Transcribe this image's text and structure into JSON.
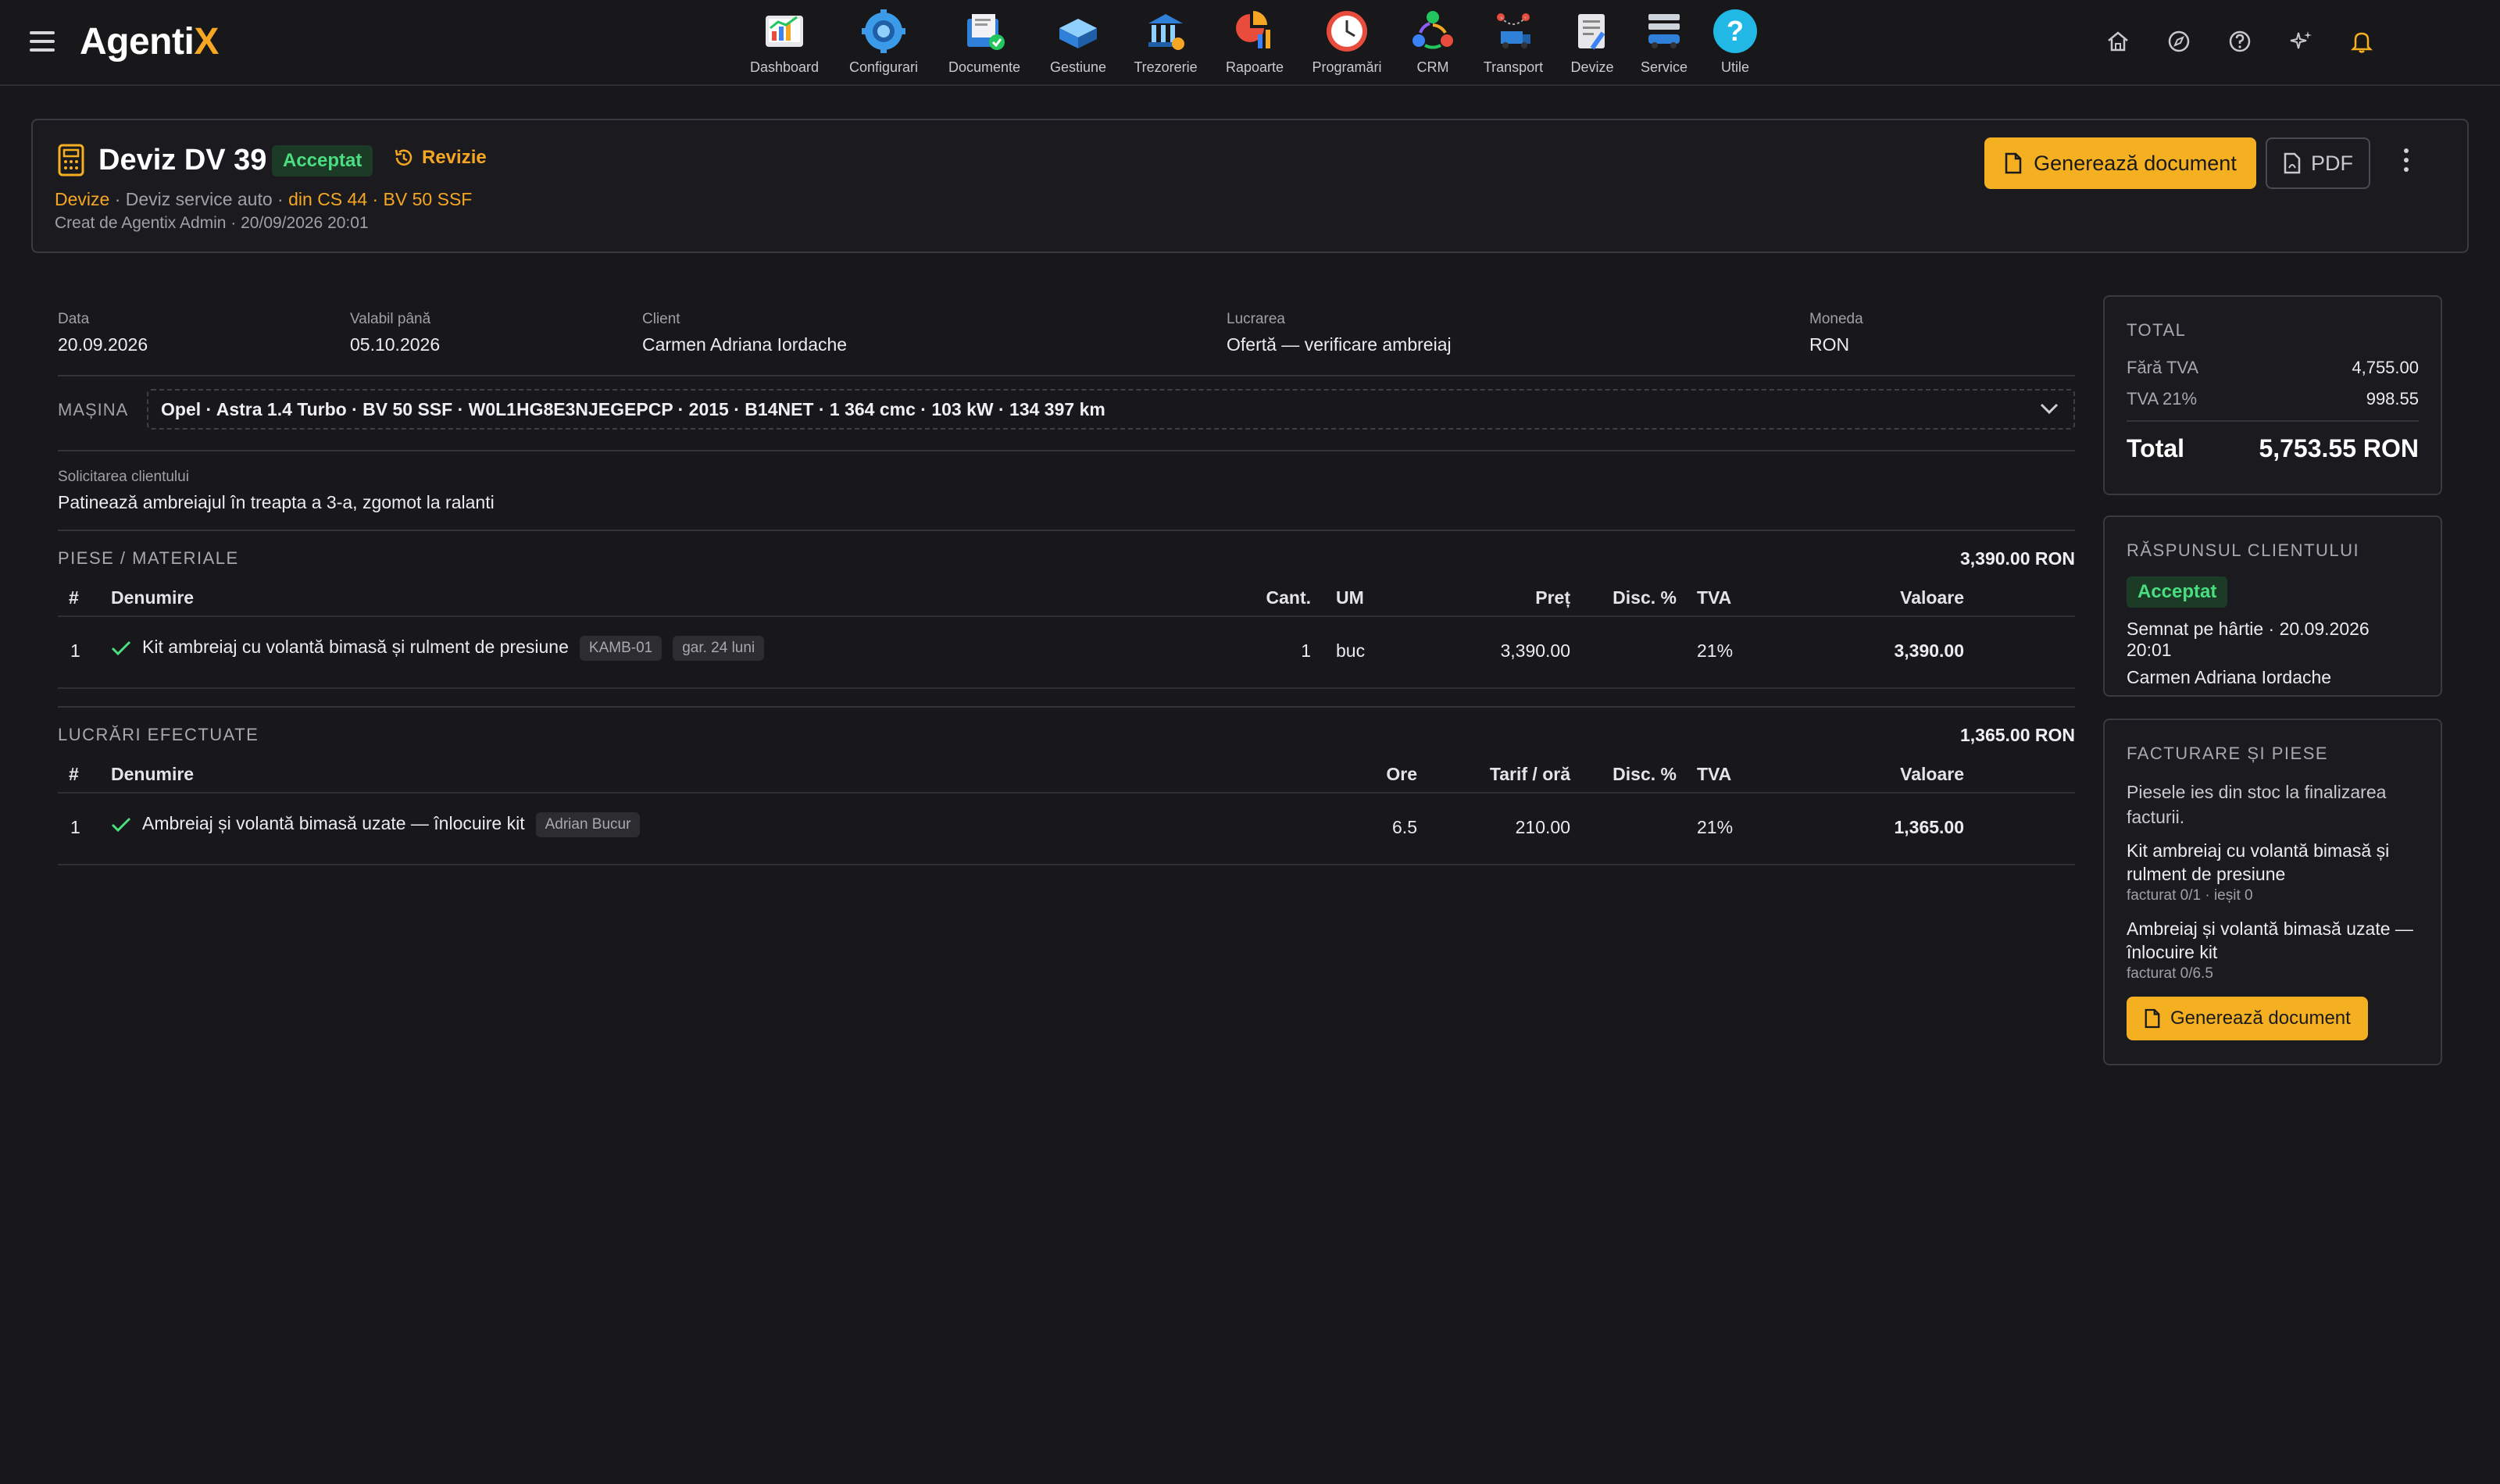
{
  "app": {
    "logo_main": "Agenti",
    "logo_accent": "X"
  },
  "nav": [
    {
      "label": "Dashboard",
      "icon": "dashboard-icon"
    },
    {
      "label": "Configurari",
      "icon": "configurari-icon"
    },
    {
      "label": "Documente",
      "icon": "documente-icon"
    },
    {
      "label": "Gestiune",
      "icon": "gestiune-icon"
    },
    {
      "label": "Trezorerie",
      "icon": "trezorerie-icon"
    },
    {
      "label": "Rapoarte",
      "icon": "rapoarte-icon"
    },
    {
      "label": "Programări",
      "icon": "programari-icon"
    },
    {
      "label": "CRM",
      "icon": "crm-icon"
    },
    {
      "label": "Transport",
      "icon": "transport-icon"
    },
    {
      "label": "Devize",
      "icon": "devize-icon"
    },
    {
      "label": "Service",
      "icon": "service-icon"
    },
    {
      "label": "Utile",
      "icon": "utile-icon"
    }
  ],
  "header": {
    "title": "Deviz DV 39",
    "status": "Acceptat",
    "revizie": "Revizie",
    "crumb_link": "Devize",
    "crumb_sep1": " · Deviz service auto · ",
    "crumb_src": "din CS 44 · BV 50 SSF",
    "created": "Creat de Agentix Admin · 20/09/2026 20:01",
    "gen_label": "Generează document",
    "pdf_label": "PDF"
  },
  "meta": {
    "data_lbl": "Data",
    "data_val": "20.09.2026",
    "valabil_lbl": "Valabil până",
    "valabil_val": "05.10.2026",
    "client_lbl": "Client",
    "client_val": "Carmen Adriana Iordache",
    "lucrarea_lbl": "Lucrarea",
    "lucrarea_val": "Ofertă — verificare ambreiaj",
    "moneda_lbl": "Moneda",
    "moneda_val": "RON"
  },
  "masina": {
    "label": "MAȘINA",
    "value": "Opel · Astra 1.4 Turbo · BV 50 SSF · W0L1HG8E3NJEGEPCP · 2015 · B14NET · 1 364 cmc · 103 kW · 134 397 km"
  },
  "request": {
    "label": "Solicitarea clientului",
    "value": "Patinează ambreiajul în treapta a 3-a, zgomot la ralanti"
  },
  "piese": {
    "title": "PIESE / MATERIALE",
    "total": "3,390.00 RON",
    "cols": {
      "nr": "#",
      "den": "Denumire",
      "cant": "Cant.",
      "um": "UM",
      "pret": "Preț",
      "disc": "Disc. %",
      "tva": "TVA",
      "val": "Valoare"
    },
    "rows": [
      {
        "nr": "1",
        "den": "Kit ambreiaj cu volantă bimasă și rulment de presiune",
        "code": "KAMB-01",
        "gar": "gar. 24 luni",
        "cant": "1",
        "um": "buc",
        "pret": "3,390.00",
        "disc": "",
        "tva": "21%",
        "val": "3,390.00"
      }
    ]
  },
  "lucrari": {
    "title": "LUCRĂRI EFECTUATE",
    "total": "1,365.00 RON",
    "cols": {
      "nr": "#",
      "den": "Denumire",
      "ore": "Ore",
      "tarif": "Tarif / oră",
      "disc": "Disc. %",
      "tva": "TVA",
      "val": "Valoare"
    },
    "rows": [
      {
        "nr": "1",
        "den": "Ambreiaj și volantă bimasă uzate — înlocuire kit",
        "tech": "Adrian Bucur",
        "ore": "6.5",
        "tarif": "210.00",
        "disc": "",
        "tva": "21%",
        "val": "1,365.00"
      }
    ]
  },
  "totals": {
    "title": "TOTAL",
    "fara_lbl": "Fără TVA",
    "fara_val": "4,755.00",
    "tva_lbl": "TVA 21%",
    "tva_val": "998.55",
    "total_lbl": "Total",
    "total_val": "5,753.55 RON"
  },
  "raspuns": {
    "title": "RĂSPUNSUL CLIENTULUI",
    "status": "Acceptat",
    "line1": "Semnat pe hârtie · 20.09.2026 20:01",
    "line2": "Carmen Adriana Iordache"
  },
  "facturare": {
    "title": "FACTURARE ȘI PIESE",
    "note": "Piesele ies din stoc la finalizarea facturii.",
    "items": [
      {
        "name": "Kit ambreiaj cu volantă bimasă și rulment de presiune",
        "sub": "facturat 0/1 · ieșit 0"
      },
      {
        "name": "Ambreiaj și volantă bimasă uzate — înlocuire kit",
        "sub": "facturat 0/6.5"
      }
    ],
    "gen_label": "Generează document"
  },
  "colors": {
    "accent": "#f5b021",
    "success": "#4ade80",
    "bg": "#18181b"
  }
}
